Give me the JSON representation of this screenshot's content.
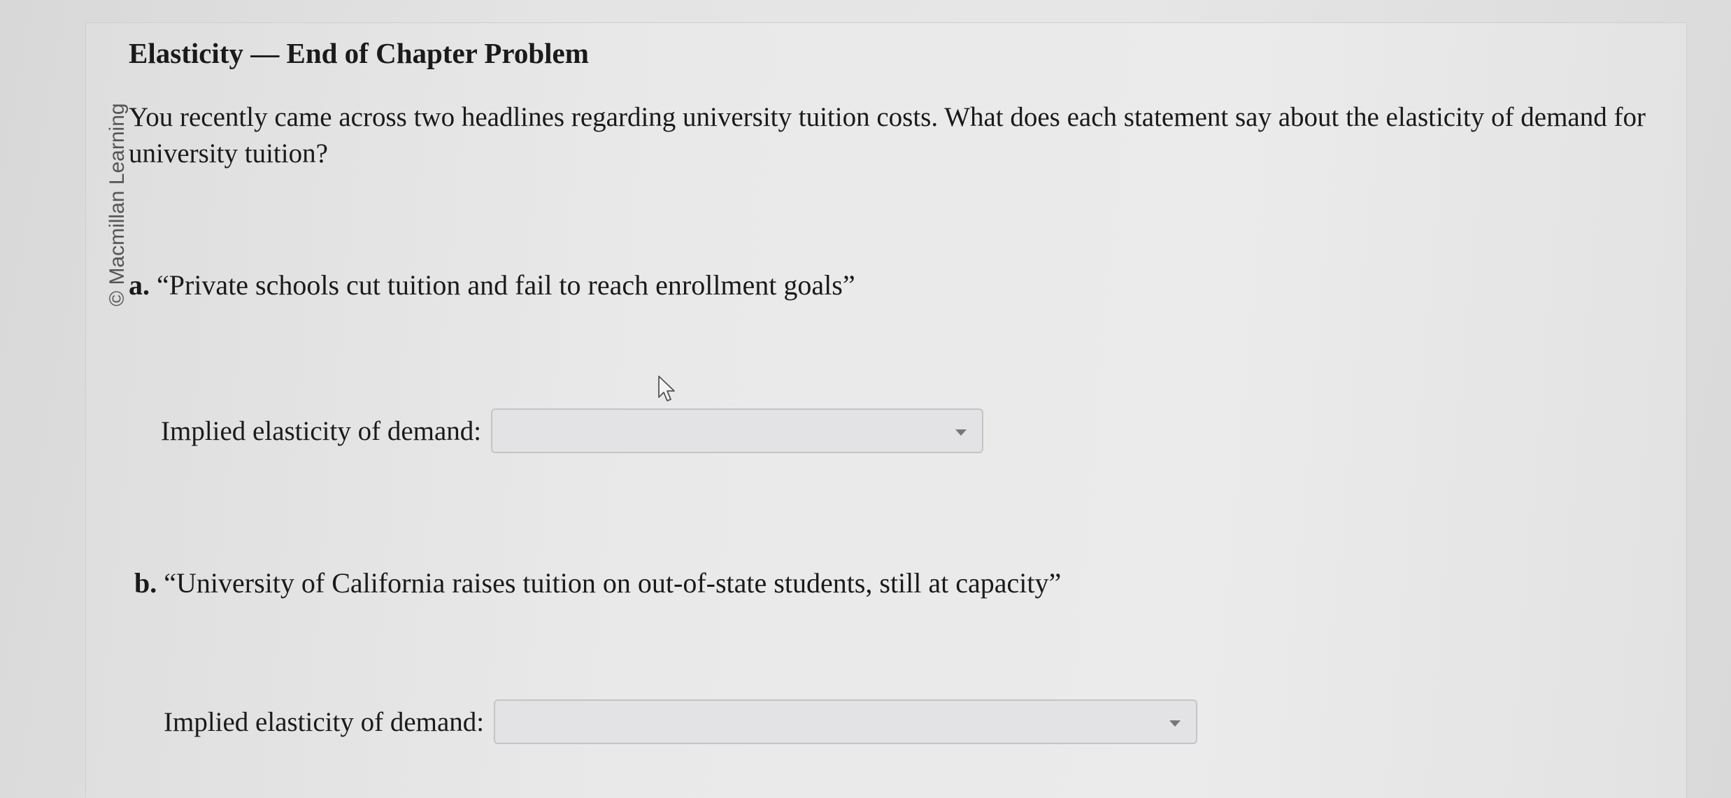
{
  "watermark": {
    "text": "© Macmillan Learning"
  },
  "problem": {
    "title": "Elasticity — End of Chapter Problem",
    "intro": "You recently came across two headlines regarding university tuition costs. What does each statement say about the elasticity of demand for university tuition?"
  },
  "questions": [
    {
      "letter": "a.",
      "headline": "“Private schools cut tuition and fail to reach enrollment goals”",
      "answer_label": "Implied elasticity of demand:",
      "selected_value": ""
    },
    {
      "letter": "b.",
      "headline": "“University of California raises tuition on out-of-state students, still at capacity”",
      "answer_label": "Implied elasticity of demand:",
      "selected_value": ""
    }
  ],
  "icons": {
    "dropdown": "chevron-down-icon",
    "cursor": "mouse-pointer-icon"
  }
}
